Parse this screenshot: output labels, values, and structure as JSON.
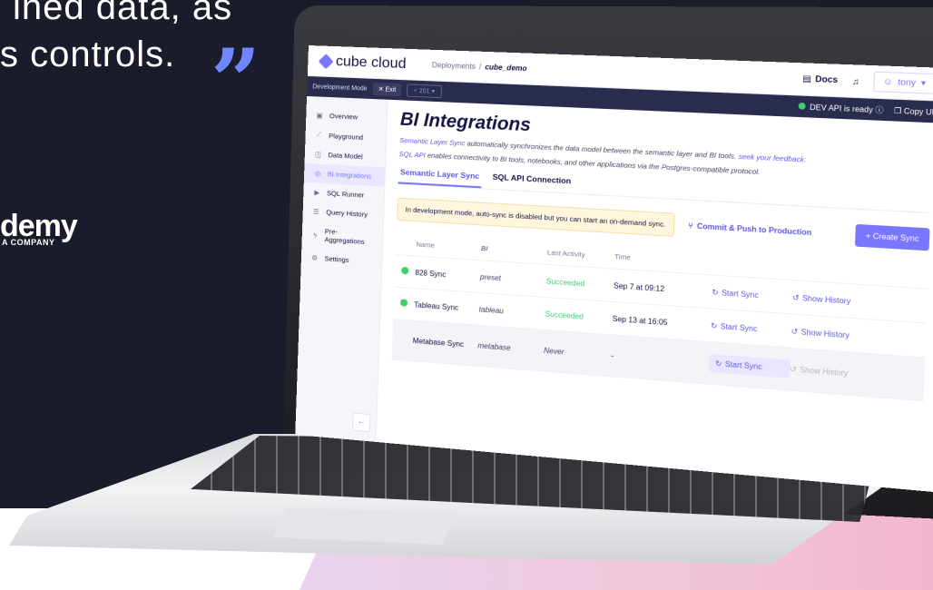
{
  "hero": {
    "line1": "ined data, as",
    "line2": "s controls.",
    "quote": "”",
    "brand": "demy",
    "brand_sub": "A COMPANY"
  },
  "app": {
    "logo_text": "cube cloud",
    "breadcrumb": {
      "root": "Deployments",
      "sep": "/",
      "current": "cube_demo"
    },
    "docs_label": "Docs",
    "user_label": "tony",
    "dev_mode_label": "Development Mode",
    "exit_label": "Exit",
    "branch_label": "201",
    "api_status": "DEV API is ready",
    "copy_url_label": "Copy URL"
  },
  "sidebar": {
    "items": [
      {
        "label": "Overview",
        "icon": "layout-icon"
      },
      {
        "label": "Playground",
        "icon": "chart-line-icon"
      },
      {
        "label": "Data Model",
        "icon": "model-icon"
      },
      {
        "label": "BI Integrations",
        "icon": "bi-icon",
        "active": true
      },
      {
        "label": "SQL Runner",
        "icon": "play-icon"
      },
      {
        "label": "Query History",
        "icon": "history-icon"
      },
      {
        "label": "Pre-Aggregations",
        "icon": "lightning-icon"
      },
      {
        "label": "Settings",
        "icon": "gear-icon"
      }
    ]
  },
  "main": {
    "title": "BI Integrations",
    "desc1_link": "Semantic Layer Sync",
    "desc1_text": "automatically synchronizes the data model between the semantic layer and BI tools.",
    "desc1_feedback": "seek your feedback.",
    "desc2_link": "SQL API",
    "desc2_text": "enables connectivity to BI tools, notebooks, and other applications via the Postgres-compatible protocol.",
    "tabs": [
      "Semantic Layer Sync",
      "SQL API Connection"
    ],
    "warning": "In development mode, auto-sync is disabled but you can start an on-demand sync.",
    "commit_label": "Commit & Push to Production",
    "create_label": "+ Create Sync",
    "columns": [
      "Name",
      "BI",
      "Last Activity",
      "Time"
    ],
    "rows": [
      {
        "name": "828 Sync",
        "bi": "preset",
        "activity": "Succeeded",
        "time": "Sep 7 at 09:12",
        "start": "Start Sync",
        "history": "Show History"
      },
      {
        "name": "Tableau Sync",
        "bi": "tableau",
        "activity": "Succeeded",
        "time": "Sep 13 at 16:05",
        "start": "Start Sync",
        "history": "Show History"
      },
      {
        "name": "Metabase Sync",
        "bi": "metabase",
        "activity": "Never",
        "time": "-",
        "start": "Start Sync",
        "history": "Show History"
      }
    ]
  },
  "colors": {
    "accent": "#7a77ff",
    "hero_bg": "#1b1c2b",
    "success": "#3ecf6f",
    "quote": "#6f86ff"
  }
}
